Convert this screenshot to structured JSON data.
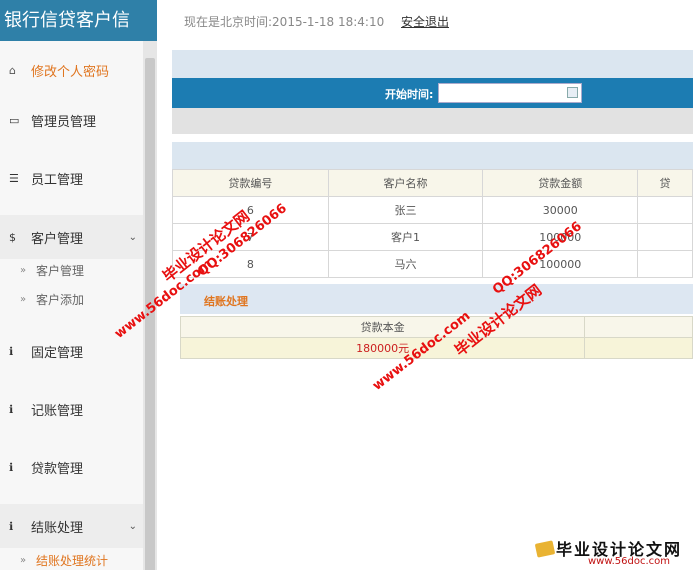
{
  "brand": {
    "title": "银行信贷客户信"
  },
  "header": {
    "time_text": "现在是北京时间:2015-1-18 18:4:10",
    "logout_label": "安全退出"
  },
  "sidebar": {
    "items": [
      {
        "label": "修改个人密码",
        "icon": "home-icon"
      },
      {
        "label": "管理员管理",
        "icon": "inbox-icon"
      },
      {
        "label": "员工管理",
        "icon": "list-icon"
      },
      {
        "label": "客户管理",
        "icon": "dollar-icon"
      },
      {
        "label": "固定管理",
        "icon": "info-icon"
      },
      {
        "label": "记账管理",
        "icon": "info-icon"
      },
      {
        "label": "贷款管理",
        "icon": "info-icon"
      },
      {
        "label": "结账处理",
        "icon": "info-icon"
      }
    ],
    "customer_sub": [
      "客户管理",
      "客户添加"
    ],
    "settle_sub": [
      "结账处理统计"
    ]
  },
  "search": {
    "label": "开始时间:",
    "value": ""
  },
  "loan_table": {
    "headers": [
      "贷款编号",
      "客户名称",
      "贷款金额",
      "贷"
    ],
    "rows": [
      [
        "6",
        "张三",
        "30000",
        ""
      ],
      [
        "7",
        "客户1",
        "100000",
        ""
      ],
      [
        "8",
        "马六",
        "100000",
        ""
      ]
    ]
  },
  "settlement": {
    "title": "结账处理",
    "headers": [
      "贷款本金",
      ""
    ],
    "values": [
      "180000元",
      ""
    ]
  },
  "watermark": {
    "site_a": "毕业设计论文网",
    "qq": "QQ:306826066",
    "url": "www.56doc.com",
    "logo_text": "毕业设计论文网",
    "logo_url": "www.56doc.com"
  }
}
